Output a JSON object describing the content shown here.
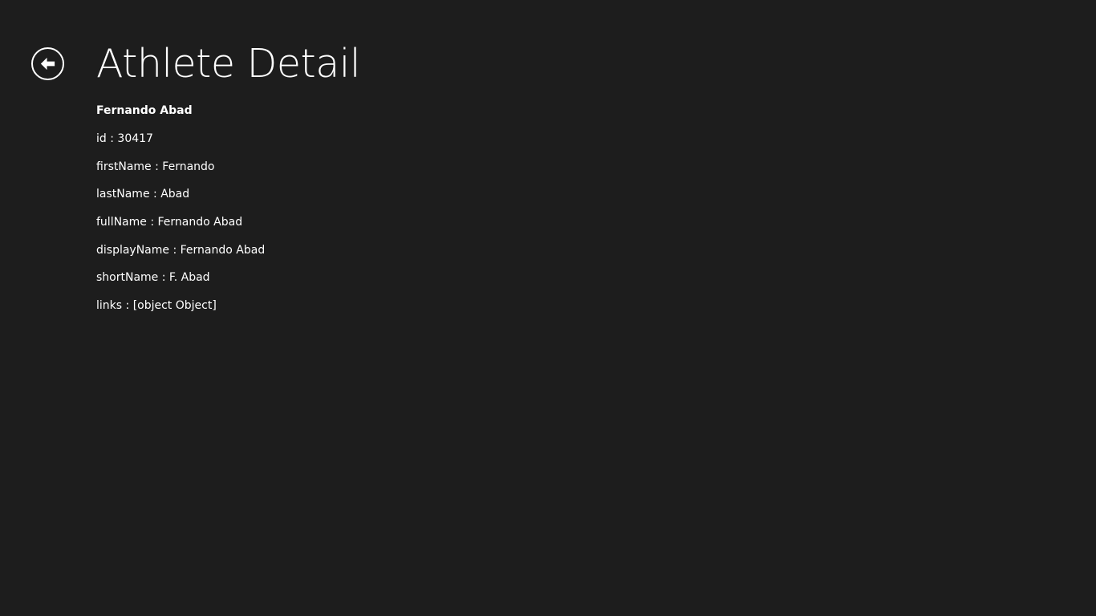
{
  "header": {
    "title": "Athlete Detail",
    "back_icon": "back-arrow-icon"
  },
  "athlete": {
    "name": "Fernando Abad",
    "fields": [
      {
        "key": "id",
        "sep": " : ",
        "value": "30417"
      },
      {
        "key": "firstName",
        "sep": " : ",
        "value": "Fernando"
      },
      {
        "key": "lastName",
        "sep": " : ",
        "value": "Abad"
      },
      {
        "key": "fullName",
        "sep": " : ",
        "value": "Fernando Abad"
      },
      {
        "key": "displayName",
        "sep": " : ",
        "value": "Fernando Abad"
      },
      {
        "key": "shortName",
        "sep": " : ",
        "value": "F. Abad"
      },
      {
        "key": "links",
        "sep": " : ",
        "value": "[object Object]"
      }
    ]
  },
  "colors": {
    "background": "#1d1d1d",
    "foreground": "#ffffff"
  }
}
